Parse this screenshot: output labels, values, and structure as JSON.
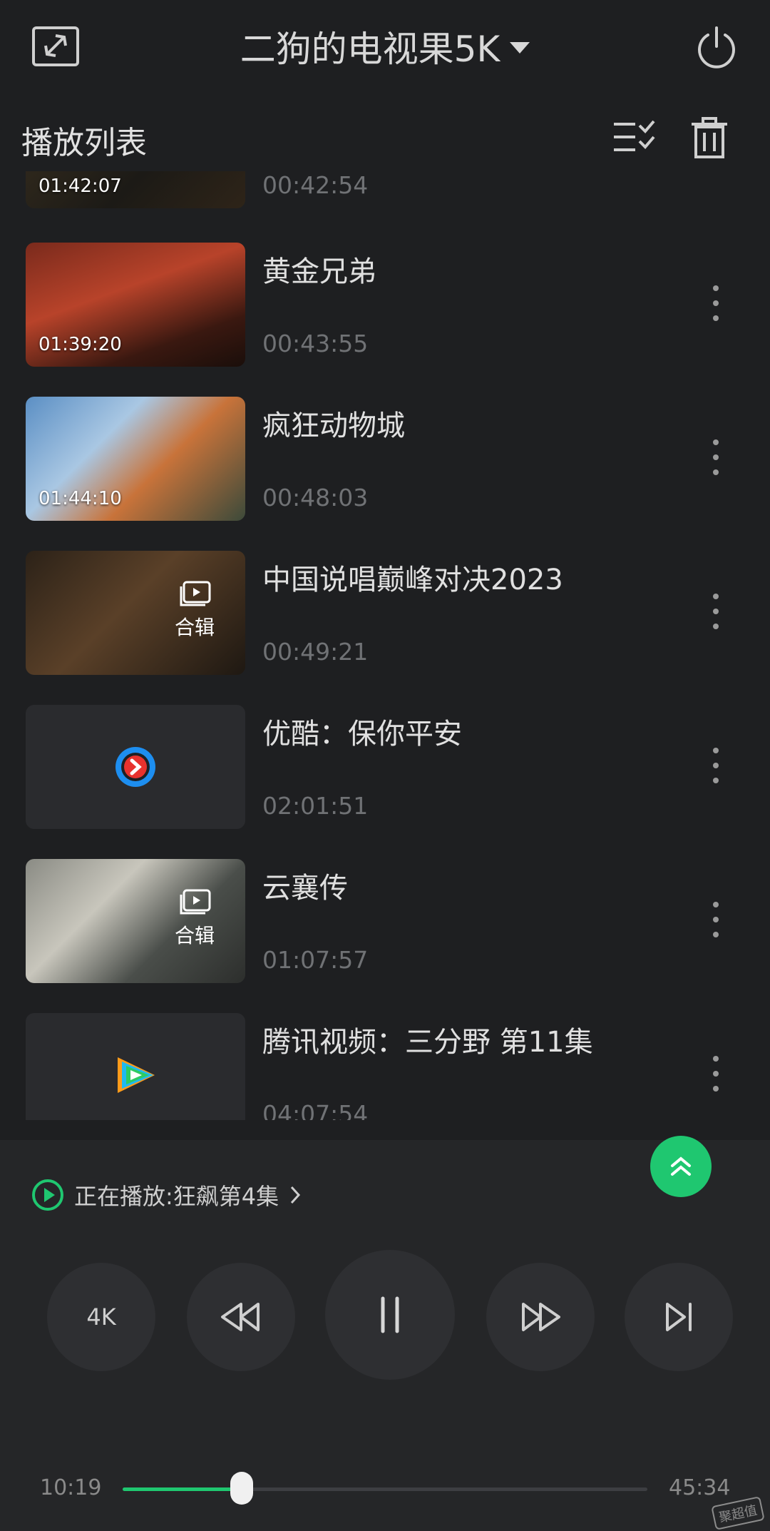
{
  "header": {
    "title": "二狗的电视果5K"
  },
  "playlist": {
    "title": "播放列表",
    "items": [
      {
        "thumb_duration": "01:42:07",
        "title": "",
        "duration": "00:42:54",
        "thumb_style": "film-dark",
        "collection": false
      },
      {
        "thumb_duration": "01:39:20",
        "title": "黄金兄弟",
        "duration": "00:43:55",
        "thumb_style": "film-red",
        "collection": false
      },
      {
        "thumb_duration": "01:44:10",
        "title": "疯狂动物城",
        "duration": "00:48:03",
        "thumb_style": "film-blue",
        "collection": false
      },
      {
        "thumb_duration": "",
        "title": "中国说唱巅峰对决2023",
        "duration": "00:49:21",
        "thumb_style": "film-brown",
        "collection": true,
        "collection_label": "合辑"
      },
      {
        "thumb_duration": "",
        "title": "优酷：保你平安",
        "duration": "02:01:51",
        "thumb_style": "logo-youku",
        "collection": false
      },
      {
        "thumb_duration": "",
        "title": "云襄传",
        "duration": "01:07:57",
        "thumb_style": "film-grey",
        "collection": true,
        "collection_label": "合辑"
      },
      {
        "thumb_duration": "",
        "title": "腾讯视频：三分野 第11集",
        "duration": "04:07:54",
        "thumb_style": "logo-tencent",
        "collection": false
      }
    ]
  },
  "player": {
    "now_playing": "正在播放:狂飙第4集",
    "quality_label": "4K",
    "elapsed": "10:19",
    "total": "45:34",
    "progress_fraction": 0.2265
  },
  "colors": {
    "accent": "#1fc770",
    "background": "#1e1f21",
    "panel": "#252628"
  },
  "watermark": "聚超值"
}
